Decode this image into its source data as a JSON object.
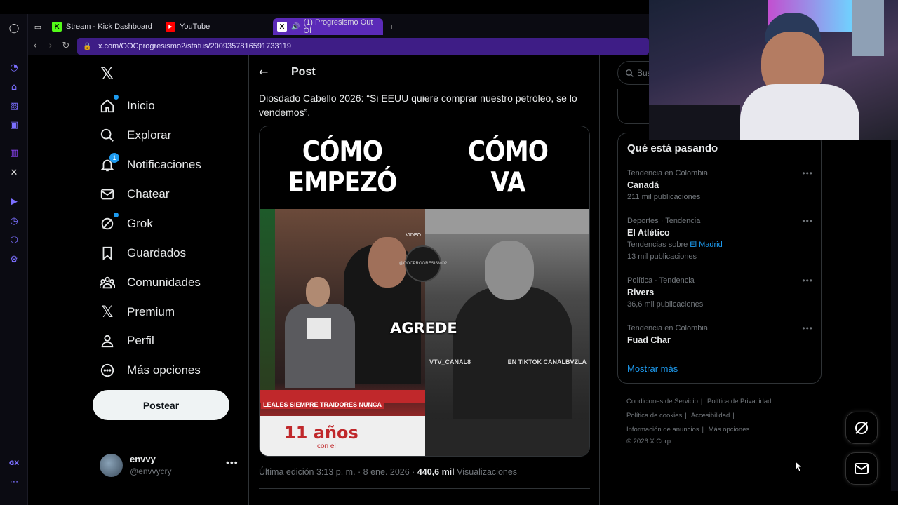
{
  "browser": {
    "tabs": [
      {
        "label": "Stream - Kick Dashboard",
        "icon": "kick-icon",
        "active": false
      },
      {
        "label": "YouTube",
        "icon": "youtube-icon",
        "active": false
      },
      {
        "label": "(1) Progresismo Out Of",
        "icon": "x-icon",
        "active": true
      }
    ],
    "url": "x.com/OOCprogresismo2/status/2009357816591733119"
  },
  "nav": {
    "items": [
      {
        "label": "Inicio",
        "icon": "home-icon"
      },
      {
        "label": "Explorar",
        "icon": "search-icon"
      },
      {
        "label": "Notificaciones",
        "icon": "bell-icon",
        "badge": "1"
      },
      {
        "label": "Chatear",
        "icon": "mail-icon"
      },
      {
        "label": "Grok",
        "icon": "grok-icon"
      },
      {
        "label": "Guardados",
        "icon": "bookmark-icon"
      },
      {
        "label": "Comunidades",
        "icon": "communities-icon"
      },
      {
        "label": "Premium",
        "icon": "x-premium-icon"
      },
      {
        "label": "Perfil",
        "icon": "person-icon"
      },
      {
        "label": "Más opciones",
        "icon": "more-circle-icon"
      }
    ],
    "post_button": "Postear"
  },
  "user": {
    "name": "envvy",
    "handle": "@envvycry"
  },
  "post": {
    "header": "Post",
    "text": "Diosdado Cabello 2026: “Si EEUU quiere comprar nuestro petróleo, se lo vendemos”.",
    "media": {
      "left_heading": [
        "CÓMO",
        "EMPEZÓ"
      ],
      "right_heading": [
        "CÓMO",
        "VA"
      ],
      "left_caption": "AGREDE",
      "banner": "LEALES SIEMPRE TRAIDORES NUNCA",
      "years": "11 años",
      "years_sub": "con el",
      "video_tag": "VIDEO",
      "stamp": "@OOCPROGRESISMO2",
      "vtv_left": "VTV_CANAL8",
      "vtv_right": "EN TIKTOK CANALBVZLA"
    },
    "meta_prefix": "Última edición 3:13 p. m. · 8 ene. 2026 · ",
    "views_count": "440,6 mil",
    "views_label": " Visualizaciones"
  },
  "search": {
    "placeholder": "Bus"
  },
  "trends": {
    "title": "Qué está pasando",
    "items": [
      {
        "context": "Tendencia en Colombia",
        "name": "Canadá",
        "count": "211 mil publicaciones"
      },
      {
        "context": "Deportes · Tendencia",
        "name": "El Atlético",
        "sub_prefix": "Tendencias sobre ",
        "sub_link": "El Madrid",
        "count": "13 mil publicaciones"
      },
      {
        "context": "Política · Tendencia",
        "name": "Rivers",
        "count": "36,6 mil publicaciones"
      },
      {
        "context": "Tendencia en Colombia",
        "name": "Fuad Char",
        "count": ""
      }
    ],
    "show_more": "Mostrar más"
  },
  "footer": {
    "links": [
      "Condiciones de Servicio",
      "Política de Privacidad",
      "Política de cookies",
      "Accesibilidad",
      "Información de anuncios",
      "Más opciones ..."
    ],
    "copyright": "© 2026 X Corp."
  },
  "colors": {
    "accent": "#1d9bf0",
    "opera_purple": "#5b2ab8",
    "background": "#000000"
  }
}
